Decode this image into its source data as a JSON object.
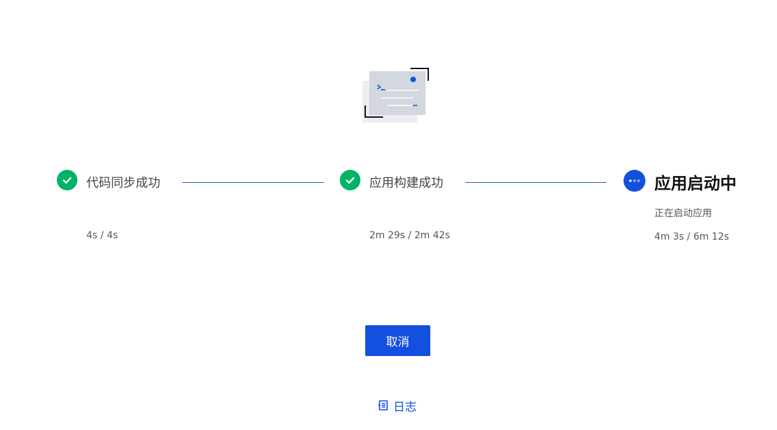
{
  "colors": {
    "success": "#00b365",
    "primary": "#1350e0",
    "connector": "#2c58c9"
  },
  "illustration": {
    "icon": "terminal-window-illustration"
  },
  "steps": [
    {
      "title": "代码同步成功",
      "subtitle": "",
      "time": "4s / 4s",
      "status": "done",
      "icon": "check-icon"
    },
    {
      "title": "应用构建成功",
      "subtitle": "",
      "time": "2m 29s / 2m 42s",
      "status": "done",
      "icon": "check-icon"
    },
    {
      "title": "应用启动中",
      "subtitle": "正在启动应用",
      "time": "4m 3s / 6m 12s",
      "status": "active",
      "icon": "more-dots-icon"
    }
  ],
  "actions": {
    "cancel_label": "取消",
    "log_label": "日志",
    "log_icon": "log-list-icon"
  }
}
